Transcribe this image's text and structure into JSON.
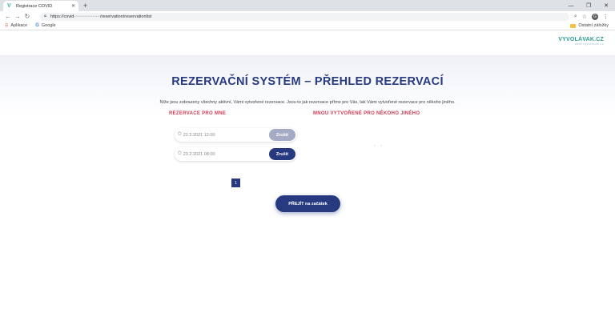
{
  "browser": {
    "tab_title": "Registrace COVID",
    "tab_favicon": "V",
    "url_prefix": "https://covid",
    "url_hidden": "•••••••••••••••••",
    "url_suffix": "/reservation/reservationlist",
    "avatar_letter": "G",
    "bookmarks": [
      "Aplikace",
      "Google"
    ],
    "other_bookmarks": "Ostatní záložky"
  },
  "header": {
    "logo_main": "VYVOLÁVAK.CZ",
    "logo_sub": "www.vyvolavak.cz"
  },
  "page": {
    "title": "REZERVAČNÍ SYSTÉM – PŘEHLED REZERVACÍ",
    "intro": "Níže jsou zobrazeny všechny aktivní, Vámi vytvořené rezervace. Jsou to jak rezervace přímo pro Vás, tak Vámi vytvořené rezervace pro někoho jiného.",
    "col_left_heading": "REZERVACE PRO MNE",
    "col_right_heading": "MNOU VYTVOŘENÉ PRO NĚKOHO JINÉHO",
    "reservations": [
      {
        "datetime": "22.2.2021 12:00",
        "cancel_label": "Zrušit",
        "enabled": false
      },
      {
        "datetime": "23.2.2021 08:00",
        "cancel_label": "Zrušit",
        "enabled": true
      }
    ],
    "loading_dots": "• •",
    "pagination": [
      "1"
    ],
    "back_button": "PŘEJÍT na začátek"
  }
}
